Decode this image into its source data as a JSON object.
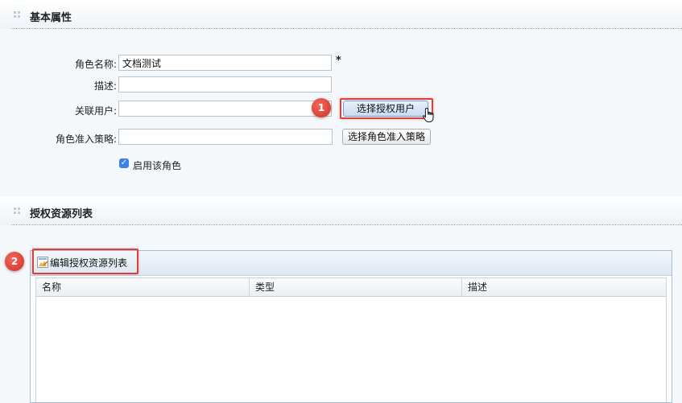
{
  "basic_section": {
    "title": "基本属性"
  },
  "form": {
    "role_name": {
      "label": "角色名称:",
      "value": "文档测试",
      "required_mark": "*"
    },
    "description": {
      "label": "描述:",
      "value": ""
    },
    "linked_users": {
      "label": "关联用户:",
      "value": "",
      "button": "选择授权用户"
    },
    "access_policy": {
      "label": "角色准入策略:",
      "value": "",
      "button": "选择角色准入策略"
    },
    "enable_role": {
      "label": "启用该角色",
      "checked": true
    }
  },
  "resource_section": {
    "title": "授权资源列表"
  },
  "toolbar": {
    "edit_label": "编辑授权资源列表"
  },
  "table": {
    "columns": [
      "名称",
      "类型",
      "描述"
    ]
  },
  "callouts": [
    "1",
    "2"
  ],
  "colors": {
    "accent": "#3a82e6",
    "highlight": "#d9413c",
    "panel_border": "#a9bfd6"
  }
}
